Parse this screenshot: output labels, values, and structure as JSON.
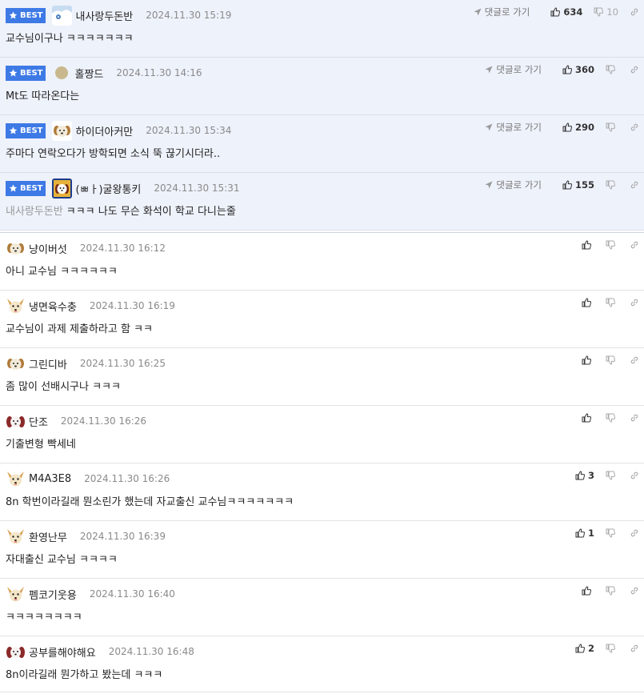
{
  "reply_label": "댓글로 가기",
  "best_label": "BEST",
  "best_comments": [
    {
      "nickname": "내사랑두돈반",
      "date": "2024.11.30 15:19",
      "text": "교수님이구나 ㅋㅋㅋㅋㅋㅋㅋ",
      "up": "634",
      "down": "10",
      "avatar": "snow-avatar"
    },
    {
      "nickname": "홀짱드",
      "date": "2024.11.30 14:16",
      "text": "Mt도 따라온다는",
      "up": "360",
      "down": "",
      "avatar": "dot-avatar"
    },
    {
      "nickname": "하이더아커만",
      "date": "2024.11.30 15:34",
      "text": "주마다 연락오다가 방학되면 소식 뚝 끊기시더라..",
      "up": "290",
      "down": "",
      "avatar": "dog-avatar"
    },
    {
      "nickname": "(ㅃㅏ)굴왕통키",
      "date": "2024.11.30 15:31",
      "mention": "내사랑두돈반",
      "text": "ㅋㅋㅋ 나도 무슨 화석이 학교 다니는줄",
      "up": "155",
      "down": "",
      "avatar": "frame-avatar"
    }
  ],
  "comments": [
    {
      "nickname": "냥이버섯",
      "date": "2024.11.30 16:12",
      "text": "아니 교수님 ㅋㅋㅋㅋㅋㅋ",
      "up": "",
      "avatar": "dog-avatar"
    },
    {
      "nickname": "냉면육수충",
      "date": "2024.11.30 16:19",
      "text": "교수님이 과제 제출하라고 함 ㅋㅋ",
      "up": "",
      "avatar": "fox-avatar"
    },
    {
      "nickname": "그린디바",
      "date": "2024.11.30 16:25",
      "text": "좀 많이 선배시구나 ㅋㅋㅋ",
      "up": "",
      "avatar": "dog-avatar"
    },
    {
      "nickname": "단조",
      "date": "2024.11.30 16:26",
      "text": "기출변형 빡세네",
      "up": "",
      "avatar": "red-avatar"
    },
    {
      "nickname": "M4A3E8",
      "date": "2024.11.30 16:26",
      "text": "8n 학번이라길래 뭔소린가 했는데 자교출신 교수님ㅋㅋㅋㅋㅋㅋㅋ",
      "up": "3",
      "avatar": "fox-avatar"
    },
    {
      "nickname": "환영난무",
      "date": "2024.11.30 16:39",
      "text": "자대출신 교수님 ㅋㅋㅋㅋ",
      "up": "1",
      "avatar": "fox-avatar"
    },
    {
      "nickname": "펨코기웃용",
      "date": "2024.11.30 16:40",
      "text": "ㅋㅋㅋㅋㅋㅋㅋㅋ",
      "up": "",
      "avatar": "fox-avatar"
    },
    {
      "nickname": "공부를해야해요",
      "date": "2024.11.30 16:48",
      "text": "8n이라길래 뭔가하고 봤는데 ㅋㅋㅋ",
      "up": "2",
      "avatar": "red-avatar"
    }
  ],
  "colors": {
    "best_badge": "#3e7ae6",
    "best_bg": "#eef2fb"
  }
}
